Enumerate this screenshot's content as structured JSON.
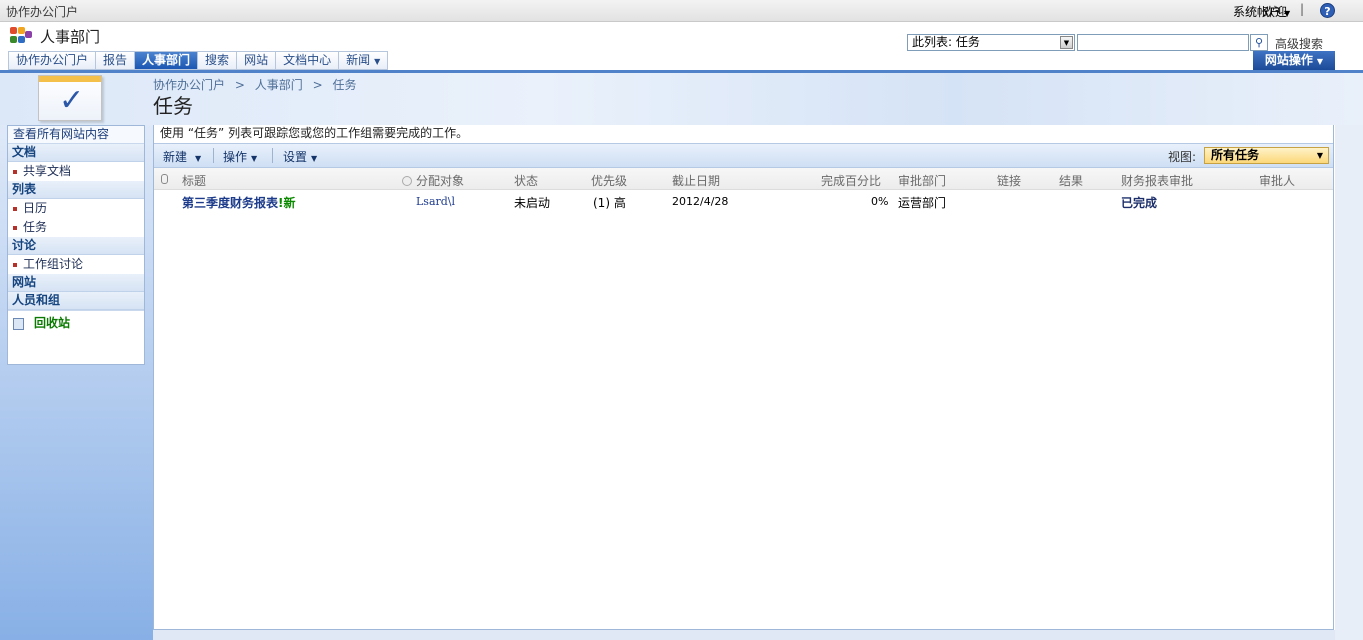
{
  "topbar": {
    "portal": "协作办公门户",
    "welcome": "欢迎",
    "account": "系统帐户",
    "sep": "|",
    "help": "?"
  },
  "site": {
    "name": "人事部门",
    "logo_colors": [
      "#e04b2a",
      "#f2a51f",
      "#3a8a2b",
      "#2f6cc4"
    ]
  },
  "search": {
    "scope": "此列表: 任务",
    "value": "",
    "advanced": "高级搜索"
  },
  "nav": {
    "tabs": [
      {
        "label": "协作办公门户"
      },
      {
        "label": "报告"
      },
      {
        "label": "人事部门",
        "active": true
      },
      {
        "label": "搜索"
      },
      {
        "label": "网站"
      },
      {
        "label": "文档中心"
      },
      {
        "label": "新闻",
        "dropdown": true
      }
    ],
    "site_actions": "网站操作"
  },
  "breadcrumb": [
    "协作办公门户",
    ">",
    "人事部门",
    ">",
    "任务"
  ],
  "page_title": "任务",
  "quicklaunch": {
    "view_all": "查看所有网站内容",
    "documents": "文档",
    "shared_docs": "共享文档",
    "lists": "列表",
    "calendar": "日历",
    "tasks": "任务",
    "discussions": "讨论",
    "team_discussion": "工作组讨论",
    "sites": "网站",
    "people": "人员和组",
    "recycle": "回收站"
  },
  "list": {
    "description": "使用 “任务” 列表可跟踪您或您的工作组需要完成的工作。",
    "toolbar": {
      "new": "新建",
      "actions": "操作",
      "settings": "设置",
      "view_label": "视图:",
      "view_value": "所有任务"
    },
    "columns": [
      "标题",
      "分配对象",
      "状态",
      "优先级",
      "截止日期",
      "完成百分比",
      "审批部门",
      "链接",
      "结果",
      "财务报表审批",
      "审批人"
    ],
    "rows": [
      {
        "title": "第三季度财务报表",
        "new_badge": "!新",
        "assigned": "Lsard\\l",
        "status": "未启动",
        "priority": "(1) 高",
        "due": "2012/4/28",
        "percent": "0%",
        "dept": "运营部门",
        "link": "",
        "result": "",
        "finance_approval": "已完成",
        "approver": ""
      }
    ]
  }
}
